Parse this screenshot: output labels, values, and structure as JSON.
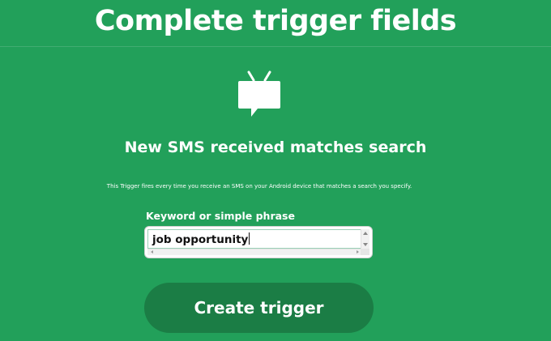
{
  "page": {
    "title": "Complete trigger fields"
  },
  "trigger": {
    "icon": "tv-chat-icon",
    "name": "New SMS received matches search",
    "description": "This Trigger fires every time you receive an SMS on your Android device that matches a search you specify."
  },
  "field": {
    "label": "Keyword or simple phrase",
    "value": "job opportunity"
  },
  "actions": {
    "create_label": "Create trigger"
  },
  "colors": {
    "background": "#22a05a",
    "button": "#1b7d45",
    "text": "#ffffff"
  }
}
